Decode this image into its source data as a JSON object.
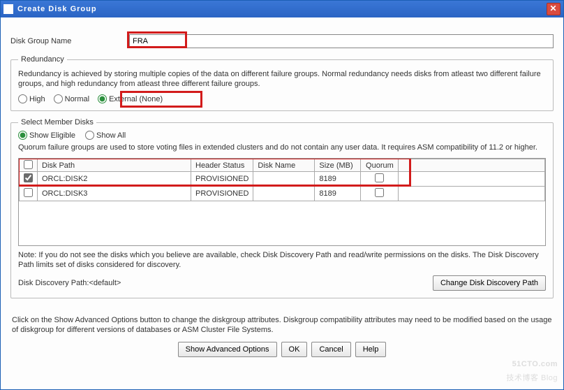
{
  "window": {
    "title": "Create Disk Group"
  },
  "diskGroup": {
    "label": "Disk Group Name",
    "value": "FRA"
  },
  "redundancy": {
    "legend": "Redundancy",
    "desc": "Redundancy is achieved by storing multiple copies of the data on different failure groups. Normal redundancy needs disks from atleast two different failure groups, and high redundancy from atleast three different failure groups.",
    "options": {
      "high": "High",
      "normal": "Normal",
      "external": "External (None)"
    },
    "selected": "external"
  },
  "member": {
    "legend": "Select Member Disks",
    "show": {
      "eligible": "Show Eligible",
      "all": "Show All",
      "selected": "eligible"
    },
    "quorumDesc": "Quorum failure groups are used to store voting files in extended clusters and do not contain any user data. It requires ASM compatibility of 11.2 or higher.",
    "headers": {
      "path": "Disk Path",
      "hs": "Header Status",
      "dn": "Disk Name",
      "size": "Size (MB)",
      "quorum": "Quorum"
    },
    "rows": [
      {
        "checked": true,
        "path": "ORCL:DISK2",
        "hs": "PROVISIONED",
        "dn": "",
        "size": "8189",
        "quorum": false
      },
      {
        "checked": false,
        "path": "ORCL:DISK3",
        "hs": "PROVISIONED",
        "dn": "",
        "size": "8189",
        "quorum": false
      }
    ],
    "note": "Note: If you do not see the disks which you believe are available, check Disk Discovery Path and read/write permissions on the disks. The Disk Discovery Path limits set of disks considered for discovery.",
    "ddpLabel": "Disk Discovery Path:<default>",
    "changeBtn": "Change Disk Discovery Path"
  },
  "footer": {
    "advNote": "Click on the Show Advanced Options button to change the diskgroup attributes. Diskgroup compatibility attributes may need to be modified based on the usage of diskgroup for different versions of databases or ASM Cluster File Systems.",
    "buttons": {
      "adv": "Show Advanced Options",
      "ok": "OK",
      "cancel": "Cancel",
      "help": "Help"
    }
  },
  "watermark": {
    "main": "51CTO.com",
    "sub": "技术博客   Blog"
  }
}
